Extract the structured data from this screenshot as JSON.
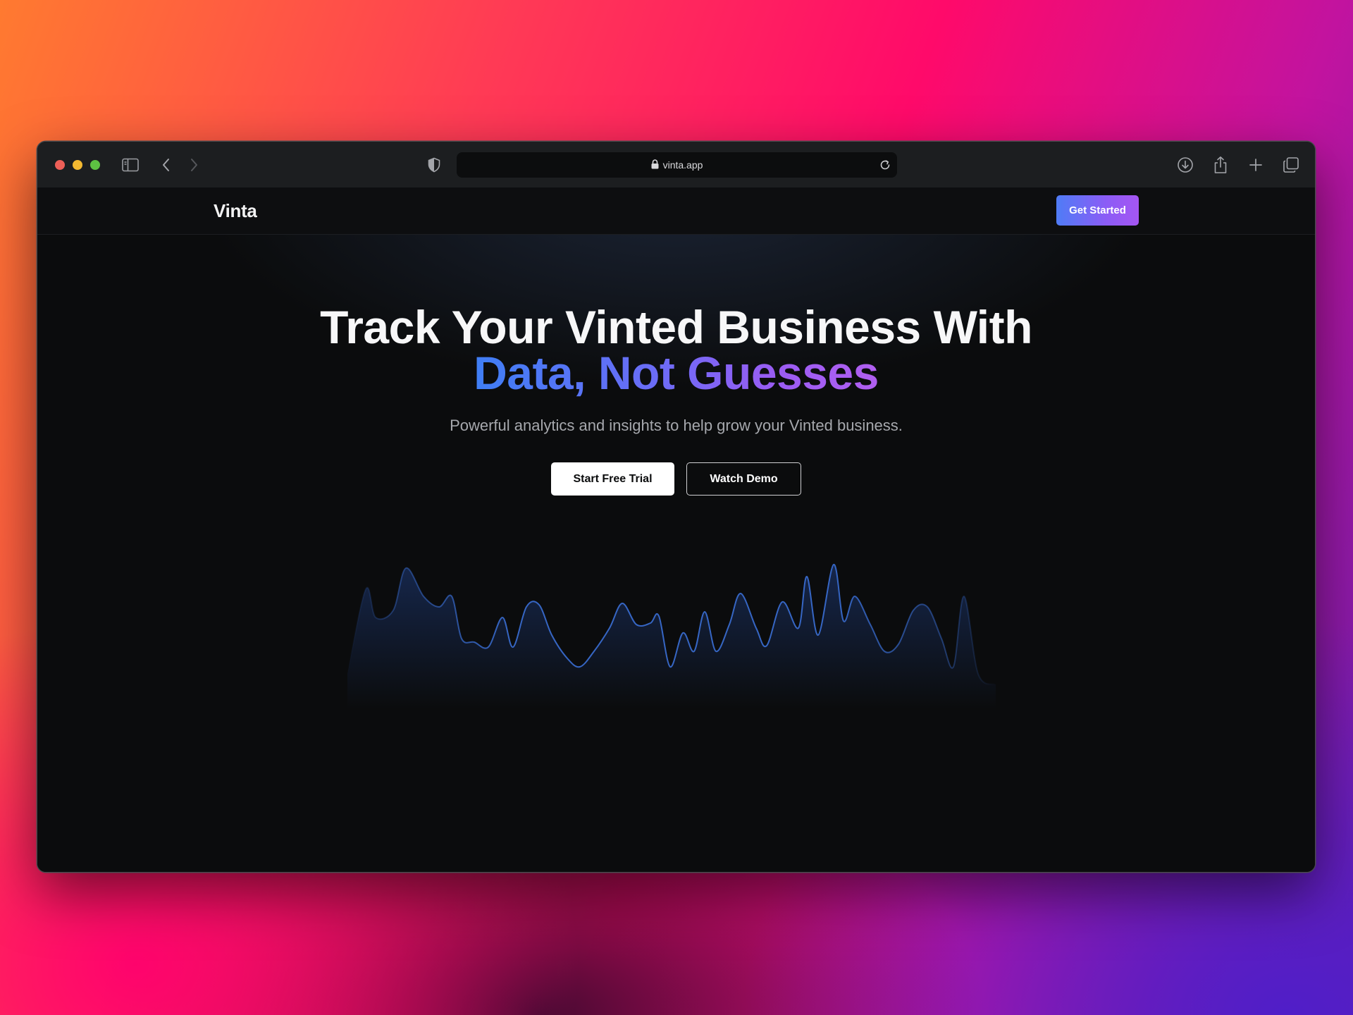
{
  "browser": {
    "url": "vinta.app",
    "icons": [
      "sidebar-icon",
      "back-icon",
      "forward-icon",
      "shield-icon",
      "lock-icon",
      "reload-icon",
      "download-icon",
      "share-icon",
      "new-tab-icon",
      "tabs-overview-icon"
    ]
  },
  "nav": {
    "brand": "Vinta",
    "cta": "Get Started"
  },
  "hero": {
    "line1": "Track Your Vinted Business With",
    "line2": "Data, Not Guesses",
    "subtitle": "Powerful analytics and insights to help grow your Vinted business.",
    "primary_button": "Start Free Trial",
    "secondary_button": "Watch Demo"
  },
  "colors": {
    "accent_start": "#4f7cf6",
    "accent_end": "#a556f2",
    "wave_stroke": "#3a6fd6"
  }
}
